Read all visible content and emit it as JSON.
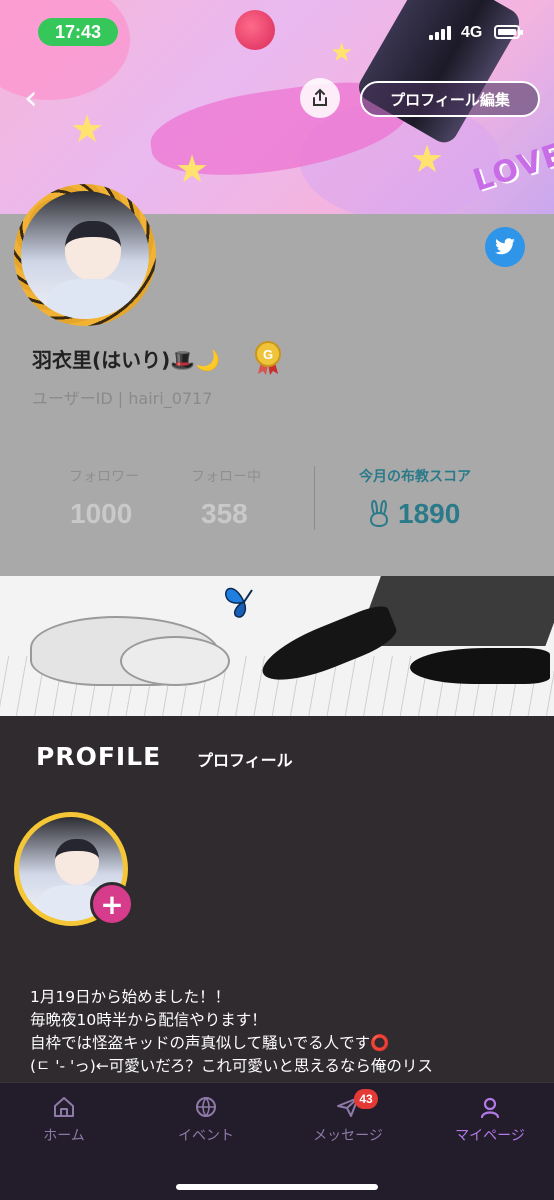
{
  "status_bar": {
    "time": "17:43",
    "network": "4G"
  },
  "header": {
    "edit_profile_label": "プロフィール編集"
  },
  "profile": {
    "display_name": "羽衣里(はいり)🎩🌙",
    "user_id_label": "ユーザーID | hairi_0717",
    "stats": [
      {
        "label": "フォロワー",
        "value": "1000"
      },
      {
        "label": "フォロー中",
        "value": "358"
      }
    ],
    "score": {
      "label": "今月の布教スコア",
      "value": "1890"
    }
  },
  "profile_section": {
    "title": "PROFILE",
    "subtitle": "プロフィール",
    "bio_lines": [
      "1月19日から始めました！！",
      "毎晩夜10時半から配信やります！",
      "自枠では怪盗キッドの声真似して騒いでる人です⭕",
      "(ㄷ '- 'っ)←可愛いだろ？これ可愛いと思えるなら俺のリス"
    ]
  },
  "tabbar": {
    "tabs": [
      {
        "label": "ホーム"
      },
      {
        "label": "イベント"
      },
      {
        "label": "メッセージ",
        "badge": "43"
      },
      {
        "label": "マイページ"
      }
    ]
  },
  "colors": {
    "accent": "#b27ae8",
    "score": "#2a7a8a",
    "badge": "#e53935",
    "plus": "#d63b8c",
    "twitter": "#2e95e8"
  }
}
